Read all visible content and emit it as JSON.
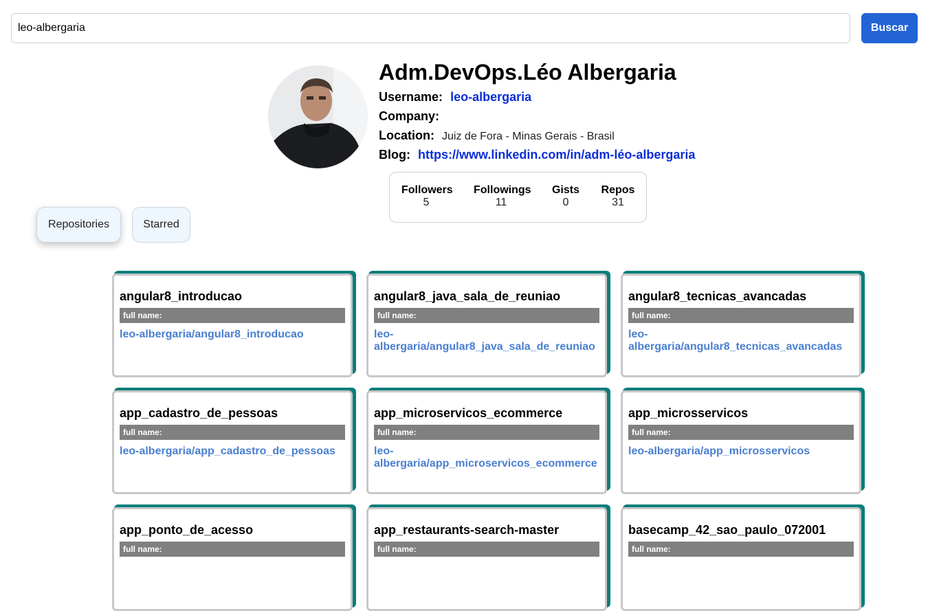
{
  "search": {
    "value": "leo-albergaria",
    "button_label": "Buscar"
  },
  "profile": {
    "name": "Adm.DevOps.Léo Albergaria",
    "username_label": "Username:",
    "username": "leo-albergaria",
    "company_label": "Company:",
    "company": "",
    "location_label": "Location:",
    "location": "Juiz de Fora - Minas Gerais - Brasil",
    "blog_label": "Blog:",
    "blog": "https://www.linkedin.com/in/adm-léo-albergaria"
  },
  "stats": [
    {
      "label": "Followers",
      "value": "5"
    },
    {
      "label": "Followings",
      "value": "11"
    },
    {
      "label": "Gists",
      "value": "0"
    },
    {
      "label": "Repos",
      "value": "31"
    }
  ],
  "tabs": [
    {
      "label": "Repositories",
      "active": true
    },
    {
      "label": "Starred",
      "active": false
    }
  ],
  "repos": [
    {
      "name": "angular8_introducao",
      "full_name_label": "full name:",
      "full_name": "leo-albergaria/angular8_introducao"
    },
    {
      "name": "angular8_java_sala_de_reuniao",
      "full_name_label": "full name:",
      "full_name": "leo-albergaria/angular8_java_sala_de_reuniao"
    },
    {
      "name": "angular8_tecnicas_avancadas",
      "full_name_label": "full name:",
      "full_name": "leo-albergaria/angular8_tecnicas_avancadas"
    },
    {
      "name": "app_cadastro_de_pessoas",
      "full_name_label": "full name:",
      "full_name": "leo-albergaria/app_cadastro_de_pessoas"
    },
    {
      "name": "app_microservicos_ecommerce",
      "full_name_label": "full name:",
      "full_name": "leo-albergaria/app_microservicos_ecommerce"
    },
    {
      "name": "app_microsservicos",
      "full_name_label": "full name:",
      "full_name": "leo-albergaria/app_microsservicos"
    },
    {
      "name": "app_ponto_de_acesso",
      "full_name_label": "full name:",
      "full_name": ""
    },
    {
      "name": "app_restaurants-search-master",
      "full_name_label": "full name:",
      "full_name": ""
    },
    {
      "name": "basecamp_42_sao_paulo_072001",
      "full_name_label": "full name:",
      "full_name": ""
    }
  ],
  "colors": {
    "accent": "#2264d6",
    "link": "#0b2ed6",
    "card_accent": "#0a7e7b",
    "repo_link": "#4a7fd0"
  }
}
